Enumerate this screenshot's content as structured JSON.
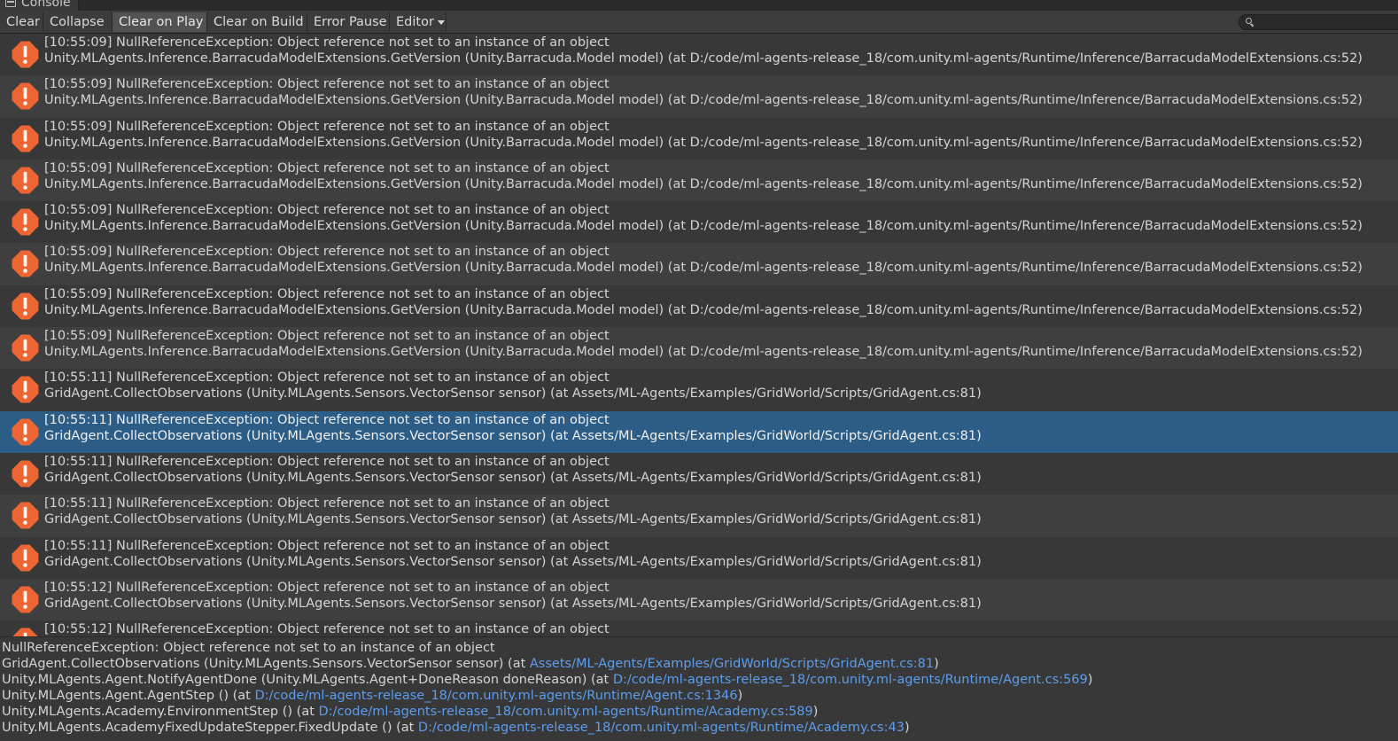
{
  "window": {
    "tab_title": "Console"
  },
  "toolbar": {
    "clear": "Clear",
    "collapse": "Collapse",
    "clear_on_play": "Clear on Play",
    "clear_on_build": "Clear on Build",
    "error_pause": "Error Pause",
    "editor": "Editor",
    "search_value": ""
  },
  "colors": {
    "error_icon": "#ec6533",
    "selected_row": "#2c5d87",
    "link": "#5c9ded"
  },
  "log_entries": [
    {
      "line1": "[10:55:09] NullReferenceException: Object reference not set to an instance of an object",
      "line2": "Unity.MLAgents.Inference.BarracudaModelExtensions.GetVersion (Unity.Barracuda.Model model) (at D:/code/ml-agents-release_18/com.unity.ml-agents/Runtime/Inference/BarracudaModelExtensions.cs:52)",
      "selected": false
    },
    {
      "line1": "[10:55:09] NullReferenceException: Object reference not set to an instance of an object",
      "line2": "Unity.MLAgents.Inference.BarracudaModelExtensions.GetVersion (Unity.Barracuda.Model model) (at D:/code/ml-agents-release_18/com.unity.ml-agents/Runtime/Inference/BarracudaModelExtensions.cs:52)",
      "selected": false
    },
    {
      "line1": "[10:55:09] NullReferenceException: Object reference not set to an instance of an object",
      "line2": "Unity.MLAgents.Inference.BarracudaModelExtensions.GetVersion (Unity.Barracuda.Model model) (at D:/code/ml-agents-release_18/com.unity.ml-agents/Runtime/Inference/BarracudaModelExtensions.cs:52)",
      "selected": false
    },
    {
      "line1": "[10:55:09] NullReferenceException: Object reference not set to an instance of an object",
      "line2": "Unity.MLAgents.Inference.BarracudaModelExtensions.GetVersion (Unity.Barracuda.Model model) (at D:/code/ml-agents-release_18/com.unity.ml-agents/Runtime/Inference/BarracudaModelExtensions.cs:52)",
      "selected": false
    },
    {
      "line1": "[10:55:09] NullReferenceException: Object reference not set to an instance of an object",
      "line2": "Unity.MLAgents.Inference.BarracudaModelExtensions.GetVersion (Unity.Barracuda.Model model) (at D:/code/ml-agents-release_18/com.unity.ml-agents/Runtime/Inference/BarracudaModelExtensions.cs:52)",
      "selected": false
    },
    {
      "line1": "[10:55:09] NullReferenceException: Object reference not set to an instance of an object",
      "line2": "Unity.MLAgents.Inference.BarracudaModelExtensions.GetVersion (Unity.Barracuda.Model model) (at D:/code/ml-agents-release_18/com.unity.ml-agents/Runtime/Inference/BarracudaModelExtensions.cs:52)",
      "selected": false
    },
    {
      "line1": "[10:55:09] NullReferenceException: Object reference not set to an instance of an object",
      "line2": "Unity.MLAgents.Inference.BarracudaModelExtensions.GetVersion (Unity.Barracuda.Model model) (at D:/code/ml-agents-release_18/com.unity.ml-agents/Runtime/Inference/BarracudaModelExtensions.cs:52)",
      "selected": false
    },
    {
      "line1": "[10:55:09] NullReferenceException: Object reference not set to an instance of an object",
      "line2": "Unity.MLAgents.Inference.BarracudaModelExtensions.GetVersion (Unity.Barracuda.Model model) (at D:/code/ml-agents-release_18/com.unity.ml-agents/Runtime/Inference/BarracudaModelExtensions.cs:52)",
      "selected": false
    },
    {
      "line1": "[10:55:11] NullReferenceException: Object reference not set to an instance of an object",
      "line2": "GridAgent.CollectObservations (Unity.MLAgents.Sensors.VectorSensor sensor) (at Assets/ML-Agents/Examples/GridWorld/Scripts/GridAgent.cs:81)",
      "selected": false
    },
    {
      "line1": "[10:55:11] NullReferenceException: Object reference not set to an instance of an object",
      "line2": "GridAgent.CollectObservations (Unity.MLAgents.Sensors.VectorSensor sensor) (at Assets/ML-Agents/Examples/GridWorld/Scripts/GridAgent.cs:81)",
      "selected": true
    },
    {
      "line1": "[10:55:11] NullReferenceException: Object reference not set to an instance of an object",
      "line2": "GridAgent.CollectObservations (Unity.MLAgents.Sensors.VectorSensor sensor) (at Assets/ML-Agents/Examples/GridWorld/Scripts/GridAgent.cs:81)",
      "selected": false
    },
    {
      "line1": "[10:55:11] NullReferenceException: Object reference not set to an instance of an object",
      "line2": "GridAgent.CollectObservations (Unity.MLAgents.Sensors.VectorSensor sensor) (at Assets/ML-Agents/Examples/GridWorld/Scripts/GridAgent.cs:81)",
      "selected": false
    },
    {
      "line1": "[10:55:11] NullReferenceException: Object reference not set to an instance of an object",
      "line2": "GridAgent.CollectObservations (Unity.MLAgents.Sensors.VectorSensor sensor) (at Assets/ML-Agents/Examples/GridWorld/Scripts/GridAgent.cs:81)",
      "selected": false
    },
    {
      "line1": "[10:55:12] NullReferenceException: Object reference not set to an instance of an object",
      "line2": "GridAgent.CollectObservations (Unity.MLAgents.Sensors.VectorSensor sensor) (at Assets/ML-Agents/Examples/GridWorld/Scripts/GridAgent.cs:81)",
      "selected": false
    },
    {
      "line1": "[10:55:12] NullReferenceException: Object reference not set to an instance of an object",
      "line2": "",
      "selected": false
    }
  ],
  "detail": {
    "header": "NullReferenceException: Object reference not set to an instance of an object",
    "frames": [
      {
        "text": "GridAgent.CollectObservations (Unity.MLAgents.Sensors.VectorSensor sensor) (at ",
        "link": "Assets/ML-Agents/Examples/GridWorld/Scripts/GridAgent.cs:81",
        "suffix": ")"
      },
      {
        "text": "Unity.MLAgents.Agent.NotifyAgentDone (Unity.MLAgents.Agent+DoneReason doneReason) (at ",
        "link": "D:/code/ml-agents-release_18/com.unity.ml-agents/Runtime/Agent.cs:569",
        "suffix": ")"
      },
      {
        "text": "Unity.MLAgents.Agent.AgentStep () (at ",
        "link": "D:/code/ml-agents-release_18/com.unity.ml-agents/Runtime/Agent.cs:1346",
        "suffix": ")"
      },
      {
        "text": "Unity.MLAgents.Academy.EnvironmentStep () (at ",
        "link": "D:/code/ml-agents-release_18/com.unity.ml-agents/Runtime/Academy.cs:589",
        "suffix": ")"
      },
      {
        "text": "Unity.MLAgents.AcademyFixedUpdateStepper.FixedUpdate () (at ",
        "link": "D:/code/ml-agents-release_18/com.unity.ml-agents/Runtime/Academy.cs:43",
        "suffix": ")"
      }
    ]
  }
}
